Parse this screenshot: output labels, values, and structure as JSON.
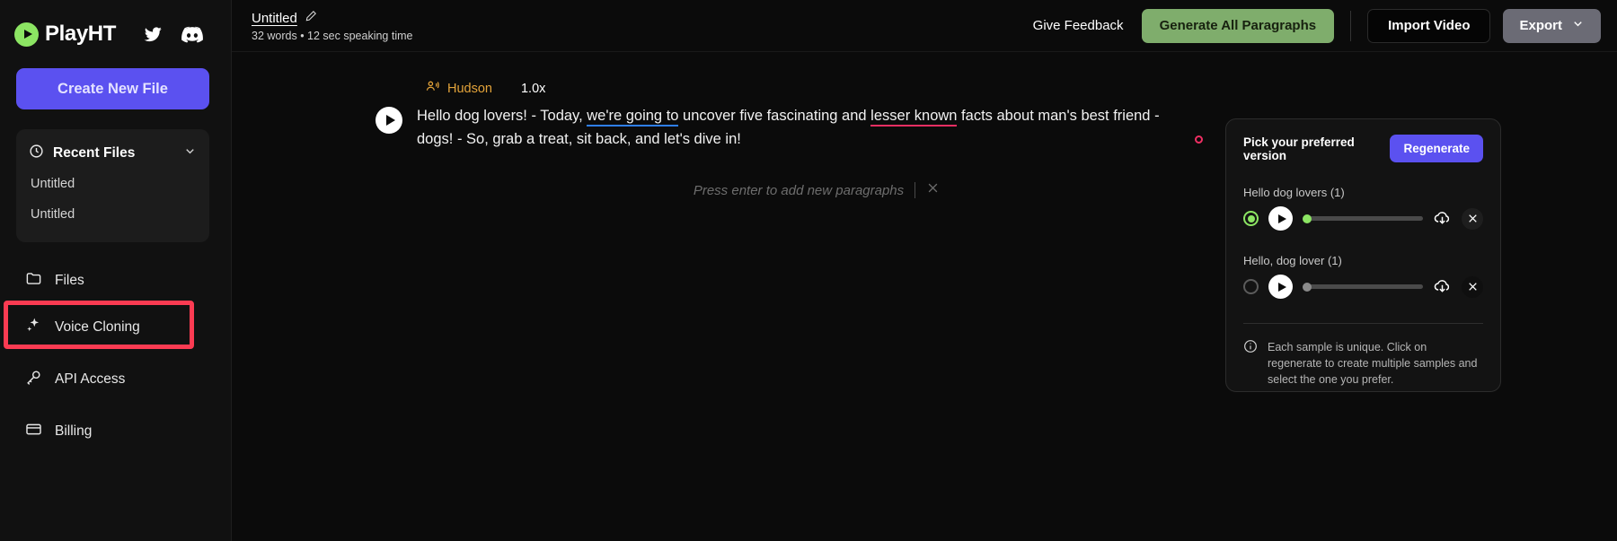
{
  "brand": {
    "name": "PlayHT",
    "logo_icon": "play-circle-icon",
    "accent": "#8ce563"
  },
  "social": [
    {
      "icon": "twitter-icon",
      "name": "twitter"
    },
    {
      "icon": "discord-icon",
      "name": "discord"
    }
  ],
  "sidebar": {
    "create_label": "Create New File",
    "recent": {
      "icon": "clock-icon",
      "title": "Recent Files",
      "chevron": "chevron-down-icon",
      "items": [
        {
          "label": "Untitled"
        },
        {
          "label": "Untitled"
        }
      ]
    },
    "nav": [
      {
        "label": "Files",
        "icon": "folder-icon",
        "highlighted": false
      },
      {
        "label": "Voice Cloning",
        "icon": "sparkles-icon",
        "highlighted": true
      },
      {
        "label": "API Access",
        "icon": "key-icon",
        "highlighted": false
      },
      {
        "label": "Billing",
        "icon": "credit-card-icon",
        "highlighted": false
      }
    ],
    "highlight_color": "#fb3b52"
  },
  "topbar": {
    "doc_title": "Untitled",
    "edit_icon": "pencil-edit-icon",
    "doc_subtitle": "32 words • 12 sec speaking time",
    "feedback_label": "Give Feedback",
    "generate_label": "Generate All Paragraphs",
    "import_label": "Import Video",
    "export_label": "Export",
    "export_chevron": "chevron-down-icon",
    "generate_color": "#7fad6c"
  },
  "editor": {
    "voice_icon": "speaker-person-icon",
    "voice_name": "Hudson",
    "speed": "1.0x",
    "play_icon": "play-icon",
    "paragraph": {
      "seg1": "Hello dog lovers! - Today, ",
      "seg2_blue": "we're going to",
      "seg3": " uncover five fascinating and ",
      "seg4_red": "lesser known",
      "seg5": " facts about man's best friend - dogs! - So, grab a treat, sit back, and let's dive in!",
      "underline_blue": "#2f7ff0",
      "underline_red": "#ef2f63"
    },
    "record_dot_icon": "record-dot-icon",
    "add_paragraph_hint": "Press enter to add new paragraphs",
    "add_paragraph_close_icon": "close-icon"
  },
  "version_panel": {
    "title": "Pick your preferred version",
    "regenerate_label": "Regenerate",
    "samples": [
      {
        "label": "Hello dog lovers (1)",
        "selected": true,
        "play_icon": "play-icon",
        "progress": 0,
        "download_icon": "download-cloud-icon",
        "close_icon": "close-icon"
      },
      {
        "label": "Hello, dog lover (1)",
        "selected": false,
        "play_icon": "play-icon",
        "progress": 0,
        "download_icon": "download-cloud-icon",
        "close_icon": "close-icon"
      }
    ],
    "info_icon": "info-icon",
    "info_text": "Each sample is unique. Click on regenerate to create multiple samples and select the one you prefer."
  }
}
